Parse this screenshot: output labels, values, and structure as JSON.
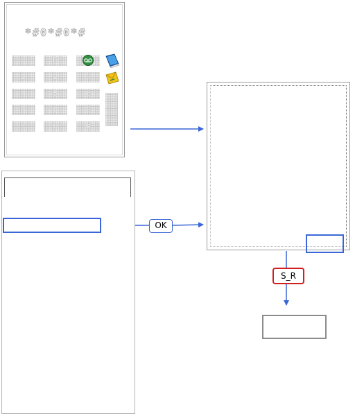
{
  "phone": {
    "display_text": "*#0*#0*#",
    "keys": [
      "",
      "R",
      "",
      "1",
      "2",
      "3",
      "4",
      "5",
      "6",
      "7",
      "8",
      "9",
      "+",
      "0",
      "#"
    ]
  },
  "flow": {
    "ok_label": "OK",
    "sr_label": "S_R"
  },
  "icons": {
    "voicemail": "voicemail-icon",
    "phonebook": "phonebook-icon",
    "messages": "message-icon"
  },
  "colors": {
    "arrow": "#3a66d6",
    "error_label": "#d11f1f",
    "key_fill": "#c9c9c9"
  }
}
